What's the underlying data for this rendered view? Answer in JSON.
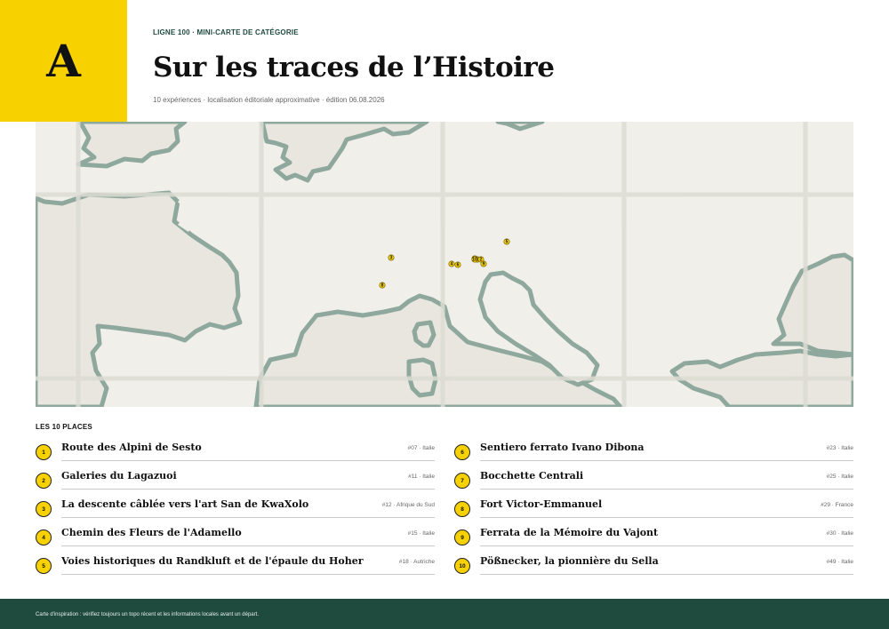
{
  "logo": {
    "letter": "A"
  },
  "header": {
    "eyebrow": "LIGNE 100 · MINI-CARTE DE CATÉGORIE",
    "title": "Sur les traces de l’Histoire",
    "meta": "10 expériences · localisation éditoriale approximative · édition 06.08.2026"
  },
  "map": {
    "markers": [
      {
        "label": "1"
      },
      {
        "label": "2"
      },
      {
        "label": "3"
      },
      {
        "label": "4"
      },
      {
        "label": "5"
      },
      {
        "label": "6"
      },
      {
        "label": "7"
      },
      {
        "label": "8"
      },
      {
        "label": "9"
      },
      {
        "label": "10"
      }
    ]
  },
  "list": {
    "heading": "LES 10 PLACES",
    "items": [
      {
        "num": "1",
        "name": "Route des Alpini de Sesto",
        "ref": "#07 · Italie"
      },
      {
        "num": "2",
        "name": "Galeries du Lagazuoi",
        "ref": "#11 · Italie"
      },
      {
        "num": "3",
        "name": "La descente câblée vers l'art San de KwaXolo",
        "ref": "#12 · Afrique du Sud"
      },
      {
        "num": "4",
        "name": "Chemin des Fleurs de l'Adamello",
        "ref": "#15 · Italie"
      },
      {
        "num": "5",
        "name": "Voies historiques du Randkluft et de l'épaule du Hoher…",
        "ref": "#18 · Autriche"
      },
      {
        "num": "6",
        "name": "Sentiero ferrato Ivano Dibona",
        "ref": "#23 · Italie"
      },
      {
        "num": "7",
        "name": "Bocchette Centrali",
        "ref": "#25 · Italie"
      },
      {
        "num": "8",
        "name": "Fort Victor-Emmanuel",
        "ref": "#29 · France"
      },
      {
        "num": "9",
        "name": "Ferrata de la Mémoire du Vajont",
        "ref": "#30 · Italie"
      },
      {
        "num": "10",
        "name": "Pößnecker, la pionnière du Sella",
        "ref": "#49 · Italie"
      }
    ]
  },
  "footer": {
    "text": "Carte d'inspiration : vérifiez toujours un topo récent et les informations locales avant un départ."
  },
  "colors": {
    "accent": "#f7d200",
    "brand": "#1f4a3e",
    "land": "#e9e6df",
    "sea": "#f1efea",
    "border": "#8fa89d"
  }
}
